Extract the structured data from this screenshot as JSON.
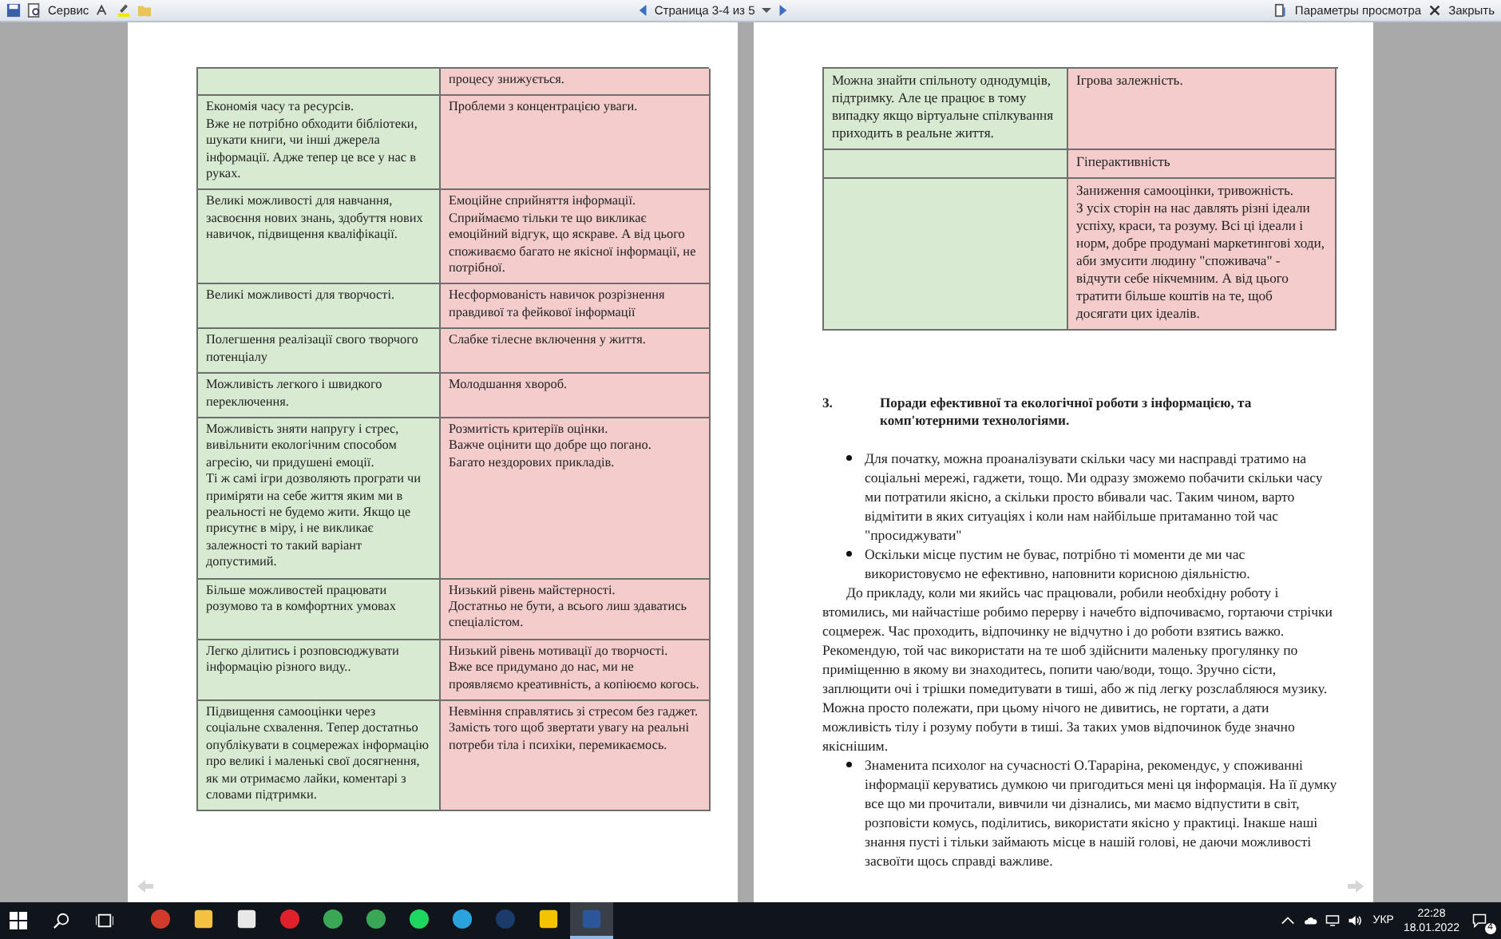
{
  "toolbar": {
    "service_menu": "Сервис",
    "page_indicator": "Страница 3-4 из 5",
    "view_options": "Параметры просмотра",
    "close": "Закрыть"
  },
  "left_page": {
    "table_rows": [
      {
        "con": "процесу знижується."
      },
      {
        "pro": "Економія часу та ресурсів.\nВже не потрібно обходити бібліотеки, шукати книги, чи інші джерела інформації. Адже тепер це все у нас в руках.",
        "con": "Проблеми з концентрацією уваги."
      },
      {
        "pro": "Великі можливості для навчання, засвоєння нових знань, здобуття нових навичок, підвищення кваліфікації.",
        "con": "Емоційне сприйняття інформації.\nСприймаємо тільки те що викликає емоційний відгук, що яскраве.  А від цього споживаємо багато не якісної інформації,  не потрібної."
      },
      {
        "pro": "Великі можливості для творчості.",
        "con": "Несформованість  навичок розрізнення правдивої та фейкової інформації"
      },
      {
        "pro": "Полегшення реалізації  свого творчого потенціалу",
        "con": "Слабке тілесне включення у життя."
      },
      {
        "pro": "Можливість легкого і швидкого переключення.",
        "con": "Молодшання хвороб."
      },
      {
        "pro": "Можливість зняти напругу і стрес, вивільнити екологічним способом агресію, чи придушені емоції.\nТі ж самі ігри дозволяють програти чи приміряти на себе життя яким ми в реальності не будемо жити. Якщо це присутнє в міру, і не викликає залежності  то такий варіант допустимий.",
        "con": "Розмитість критеріїв  оцінки.\nВажче оцінити що добре що погано.\nБагато нездорових прикладів."
      },
      {
        "pro": "Більше можливостей працювати розумово та в комфортних умовах",
        "con": "Низький рівень майстерності.\nДостатньо не бути, а всього лиш здаватись спеціалістом."
      },
      {
        "pro": "Легко ділитись і розповсюджувати інформацію різного виду..",
        "con": "Низький рівень мотивації до творчості.\nВже все придумано до нас, ми не проявляємо креативність, а копіюємо когось."
      },
      {
        "pro": "Підвищення самооцінки через соціальне схвалення. Тепер достатньо опублікувати в соцмережах інформацію про великі і маленькі свої досягнення, як ми отримаємо лайки, коментарі  з словами підтримки.",
        "con": "Невміння справлятись зі стресом без гаджет. Замість того щоб звертати увагу на реальні  потреби тіла і психіки, перемикаємось."
      }
    ]
  },
  "right_page": {
    "table_rows": [
      {
        "pro": "Можна знайти спільноту однодумців, підтримку. Але це працює в тому випадку якщо віртуальне  спілкування приходить в реальне життя.",
        "con": "Ігрова залежність."
      },
      {
        "con": "Гіперактивність"
      },
      {
        "con": "Заниження самооцінки, тривожність.\nЗ усіх сторін на нас давлять різні ідеали успіху, краси, та розуму.  Всі ці ідеали і норм, добре продумані маркетингові ходи, аби змусити людину \"споживача\" - відчути себе нікчемним.  А від цього тратити більше  коштів на те, щоб досягати цих ідеалів."
      }
    ],
    "section": {
      "number": "3.",
      "title": "Поради ефективної та екологічної роботи з інформацією, та комп'ютерними  технологіями."
    },
    "paragraphs": [
      {
        "kind": "bullet",
        "text": "Для початку, можна проаналізувати  скільки часу ми насправді тратимо на соціальні  мережі,  гаджети, тощо.  Ми одразу  зможемо побачити скільки часу ми потратили якісно, а скільки просто вбивали час. Таким чином, варто відмітити в яких ситуаціях і коли нам найбільше  притаманно той час \"просиджувати\""
      },
      {
        "kind": "bullet",
        "text": "Оскільки місце пустим не буває, потрібно ті моменти де ми час використовуємо не ефективно, наповнити корисною діяльністю."
      },
      {
        "kind": "plain",
        "text": "До прикладу, коли ми якийсь час працювали, робили необхідну роботу і втомились, ми найчастіше робимо перерву і начебто відпочиваємо, гортаючи стрічки соцмереж. Час проходить, відпочинку не відчутно і до роботи взятись важко. Рекомендую,  той час використати на те шоб здійснити маленьку прогулянку по приміщенню в якому ви знаходитесь,  попити чаю/води, тощо. Зручно сісти, заплющити очі і трішки помедитувати в тиші, або ж під легку розслабляюся  музику. Можна просто полежати, при цьому нічого не дивитись, не гортати, а дати можливість тілу і розуму побути в тиші. За таких умов відпочинок буде значно якіснішим."
      },
      {
        "kind": "bullet",
        "text": "Знаменита психолог на сучасності О.Тарарiна, рекомендує, у споживанні інформації  керуватись думкою чи пригодиться мені ця інформація.  На її думку все що ми прочитали, вивчили чи дізнались, ми маємо відпустити в світ, розповісти комусь, поділитись,  використати якісно у практиці. Інакше наші знання пусті і тільки займають місце в нашій голові, не даючи можливості засвоїти щось справді важливе."
      }
    ]
  },
  "taskbar": {
    "apps": [
      {
        "kind": "browser",
        "selected": false
      },
      {
        "kind": "folder",
        "selected": false
      },
      {
        "kind": "store",
        "selected": false
      },
      {
        "kind": "opera",
        "selected": false
      },
      {
        "kind": "chrome",
        "selected": false
      },
      {
        "kind": "chrome",
        "selected": false
      },
      {
        "kind": "spotify",
        "selected": false
      },
      {
        "kind": "telegram",
        "selected": false
      },
      {
        "kind": "steam",
        "selected": false
      },
      {
        "kind": "yellow",
        "selected": false
      },
      {
        "kind": "word",
        "selected": true
      }
    ],
    "language": "УКР",
    "time": "22:28",
    "date": "18.01.2022",
    "notifications": "4"
  }
}
